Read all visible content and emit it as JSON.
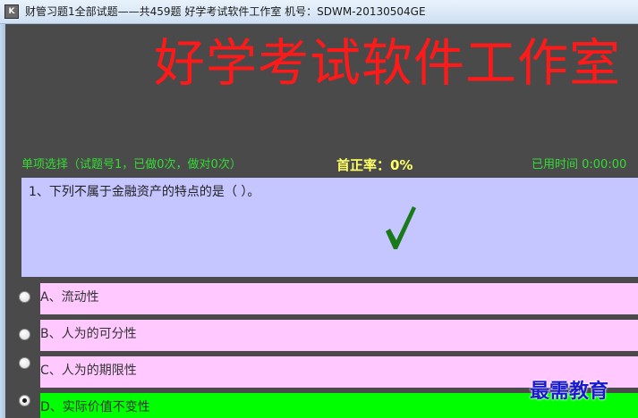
{
  "window": {
    "title": "财管习题1全部试题——共459题  好学考试软件工作室  机号：SDWM-20130504GE",
    "icon": "app-icon"
  },
  "banner": {
    "title": "好学考试软件工作室",
    "color": "#ff1a1a"
  },
  "status": {
    "question_info": "单项选择（试题号1，已做0次，做对0次）",
    "accuracy": "首正率：0%",
    "elapsed": "已用时间 0:00:00"
  },
  "question": {
    "text": "1、下列不属于金融资产的特点的是（   ）。",
    "result_icon": "check-mark-icon"
  },
  "options": [
    {
      "label": "A、流动性",
      "selected": false
    },
    {
      "label": "B、人为的可分性",
      "selected": false
    },
    {
      "label": "C、人为的期限性",
      "selected": false
    },
    {
      "label": "D、实际价值不变性",
      "selected": true
    }
  ],
  "watermark": {
    "text": "最需教育"
  },
  "colors": {
    "background": "#4a4a4a",
    "question_bg": "#c5c5ff",
    "option_bg": "#ffc8ff",
    "selected_option_bg": "#00ff00",
    "status_green": "#33dd33",
    "accuracy_yellow": "#ffff66"
  }
}
